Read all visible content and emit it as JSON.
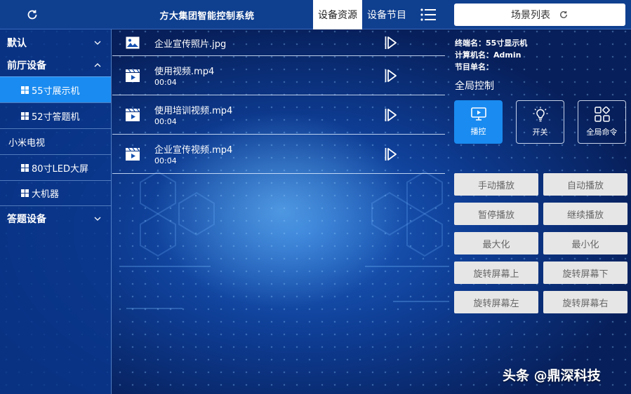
{
  "header": {
    "title": "方大集团智能控制系统",
    "tabs": [
      {
        "label": "设备资源",
        "active": true
      },
      {
        "label": "设备节目",
        "active": false
      }
    ],
    "scene_button": "场景列表"
  },
  "sidebar": {
    "groups": [
      {
        "label": "默认",
        "expanded": false
      },
      {
        "label": "前厅设备",
        "expanded": true
      },
      {
        "label": "答题设备",
        "expanded": false
      }
    ],
    "items": [
      {
        "label": "55寸展示机",
        "active": true
      },
      {
        "label": "52寸答题机",
        "active": false
      },
      {
        "label": "小米电视",
        "active": false
      },
      {
        "label": "80寸LED大屏",
        "active": false
      },
      {
        "label": "大机器",
        "active": false
      }
    ]
  },
  "media": [
    {
      "name": "企业宣传照片.jpg",
      "type": "image",
      "duration": ""
    },
    {
      "name": "使用视频.mp4",
      "type": "video",
      "duration": "00:04"
    },
    {
      "name": "使用培训视频.mp4",
      "type": "video",
      "duration": "00:04"
    },
    {
      "name": "企业宣传视频.mp4",
      "type": "video",
      "duration": "00:04"
    }
  ],
  "info": {
    "terminal": "终端名：55寸显示机",
    "computer": "计算机名：Admin",
    "playlist": "节目单名："
  },
  "global_control": {
    "title": "全局控制",
    "cards": [
      {
        "label": "播控",
        "icon": "monitor-play-icon",
        "active": true
      },
      {
        "label": "开关",
        "icon": "lightbulb-icon",
        "active": false
      },
      {
        "label": "全局命令",
        "icon": "grid-shapes-icon",
        "active": false
      }
    ],
    "commands": [
      "手动播放",
      "自动播放",
      "暂停播放",
      "继续播放",
      "最大化",
      "最小化",
      "旋转屏幕上",
      "旋转屏幕下",
      "旋转屏幕左",
      "旋转屏幕右"
    ]
  },
  "watermark": "头条 @鼎深科技",
  "colors": {
    "accent": "#1a8bf0",
    "topbar": "#0f3f8f",
    "sidebar": "#0a378c",
    "button_bg": "#e6e6e6"
  }
}
